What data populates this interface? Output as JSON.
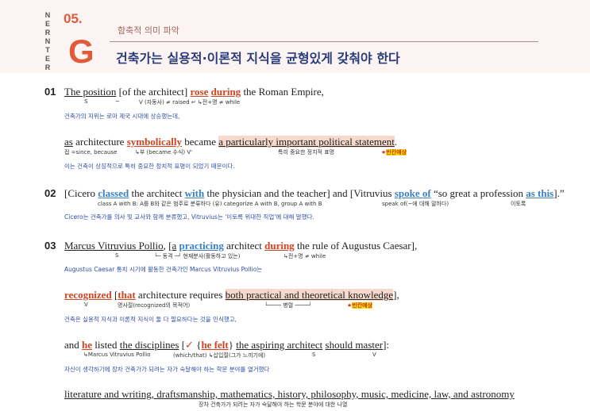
{
  "header": {
    "vertical": "NERNTER",
    "number": "05.",
    "letter": "G",
    "subtitle": "함축적 의미 파악",
    "title": "건축가는 실용적·이론적 지식을 균형있게 갖춰야 한다"
  },
  "s01": {
    "num": "01",
    "a": "The position",
    "b": " [of the architect] ",
    "c": "rose",
    "d": " ",
    "e": "during",
    "f": " the Roman Empire,",
    "g1": "S",
    "g2": "~",
    "g3": "V (자동사) ≠ raised ↵ ↳전+명 ≠ while",
    "kr": "건축가의 지위는 로마 제국 시대에 상승했는데,"
  },
  "s01b": {
    "a": "as",
    "b": " architecture ",
    "c": "symbolically",
    "d": " became ",
    "e": "a particularly important political statement",
    "f": ".",
    "g1": "접 =since, because",
    "g2": "↳부 (became 수식)  V'",
    "g3": "특히 중요한 정치적 표명",
    "tag_star": "★",
    "tag": "빈칸예상",
    "kr": "이는 건축이 상징적으로 특히 중요한 정치적 표명이 되었기 때문이다."
  },
  "s02": {
    "num": "02",
    "a": "[Cicero ",
    "b": "classed",
    "c": " the architect ",
    "d": "with",
    "e": " the physician and the teacher] and [Vitruvius ",
    "f": "spoke of",
    "g": " “so great a profession ",
    "h": "as this",
    "i": "].”",
    "g1": "class A with B: A를 B와 같은 범주로 분류하다 (유) categorize A with B, group A with B",
    "g2": "speak of(~에 대해 말하다)",
    "g3": "이토록",
    "kr": "Cicero는 건축가를 의사 및 교사와 함께 분류했고, Vitruvius는 '이토록 위대한 직업'에 대해 말했다."
  },
  "s03": {
    "num": "03",
    "a": "Marcus Vitruvius Pollio",
    "b": ", [",
    "c": "a",
    "d": " ",
    "e": "practicing",
    "f": " architect ",
    "g": "during",
    "h": " the rule of Augustus Caesar],",
    "g1": "S",
    "g2": "└─ 동격 ─┘ 현재분사(활동하고 있는)",
    "g3": "↳전+명 ≠ while",
    "kr": "Augustus Caesar 통치 시기에 활동한 건축가인 Marcus Vitruvius Pollio는"
  },
  "s03b": {
    "a": "recognized",
    "b": " [",
    "c": "that",
    "d": " architecture requires ",
    "e": "both practical and theoretical knowledge",
    "f": "],",
    "g1": "V",
    "g2": "명사절(recognized의 목적어)",
    "g3": "└──── 병렬 ────┘",
    "tag_star": "★",
    "tag": "빈칸예상",
    "kr": "건축은 실용적 지식과 이론적 지식이 둘 다 필요하다는 것을 인식했고,"
  },
  "s03c": {
    "a": "and ",
    "b": "he",
    "c": " listed ",
    "d": "the disciplines",
    "e": " [",
    "f": "✓",
    "g": " {",
    "h": "he felt",
    "i": "} ",
    "j": "the aspiring architect",
    "k": " ",
    "l": "should master",
    "m": "]:",
    "g1": "↳Marcus Vitruvius Pollio",
    "g2": "(which/that) ↳삽입절(그가 느끼기에)",
    "g3": "S",
    "g4": "V",
    "kr": "자신이 생각하기에 장차 건축가가 되려는 자가 숙달해야 하는 학문 분야를 열거했다"
  },
  "s03d": {
    "a": "literature and writing, draftsmanship, mathematics, history,  philosophy, music, medicine, law, and astronomy",
    "g1": "장차 건축가가 되려는 자가 숙달해야 하는 학문 분야에 대한 나열"
  }
}
